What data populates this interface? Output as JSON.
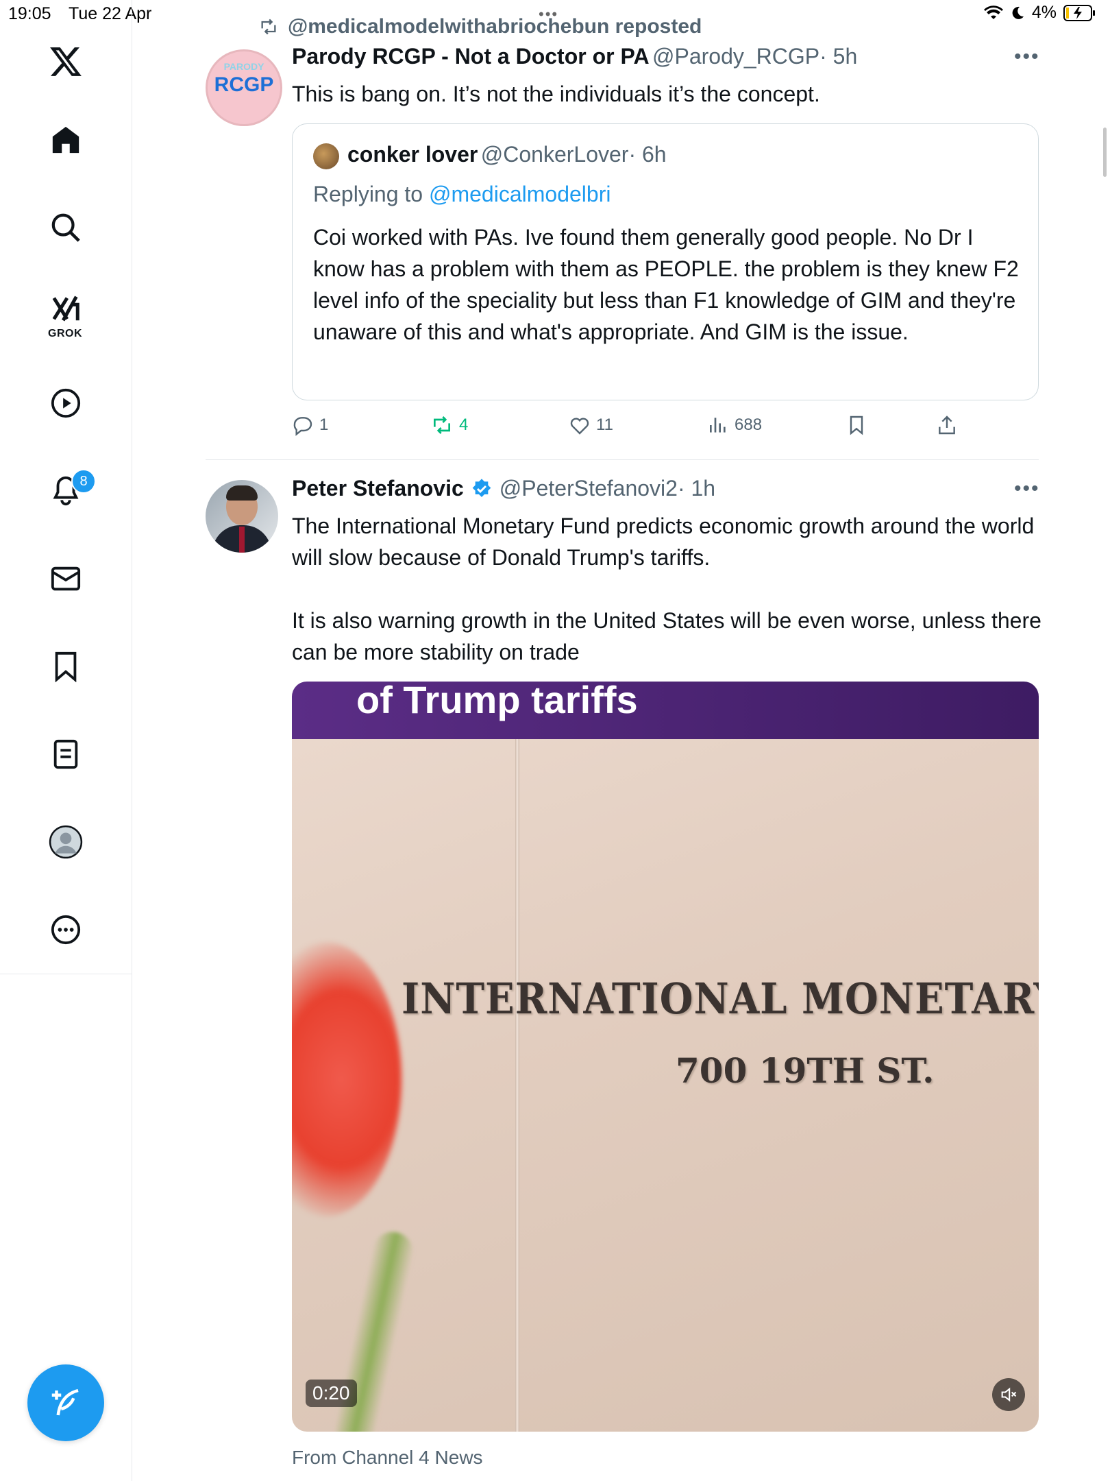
{
  "status_bar": {
    "time": "19:05",
    "date": "Tue 22 Apr",
    "battery": "4%"
  },
  "sidebar": {
    "items": [
      {
        "name": "home",
        "icon": "home-icon"
      },
      {
        "name": "search",
        "icon": "search-icon"
      },
      {
        "name": "grok",
        "icon": "grok-icon",
        "label": "GROK"
      },
      {
        "name": "videos",
        "icon": "play-icon"
      },
      {
        "name": "notifications",
        "icon": "bell-icon",
        "badge": "8"
      },
      {
        "name": "messages",
        "icon": "mail-icon"
      },
      {
        "name": "bookmarks",
        "icon": "bookmark-icon"
      },
      {
        "name": "lists",
        "icon": "list-icon"
      },
      {
        "name": "profile",
        "icon": "profile-icon"
      },
      {
        "name": "more",
        "icon": "more-icon"
      }
    ],
    "compose_icon": "compose-icon"
  },
  "repost": {
    "label": "@medicalmodelwithabriochebun reposted"
  },
  "tweet1": {
    "avatar_top": "PARODY",
    "avatar_main": "RCGP",
    "name": "Parody RCGP - Not a Doctor or PA",
    "handle": "@Parody_RCGP",
    "time": "· 5h",
    "text": "This is bang on. It’s not the individuals it’s the concept.",
    "quote": {
      "name": "conker lover",
      "handle": "@ConkerLover",
      "time": "· 6h",
      "replying_prefix": "Replying to ",
      "replying_to": "@medicalmodelbri",
      "text": "Coi worked with PAs. Ive found them generally good people. No Dr I know has a problem with them as PEOPLE. the problem is they knew F2 level info of the speciality but less than F1 knowledge of GIM and they're unaware of this and what's appropriate. And GIM is the issue."
    },
    "actions": {
      "replies": "1",
      "reposts": "4",
      "likes": "11",
      "views": "688"
    }
  },
  "tweet2": {
    "name": "Peter Stefanovic",
    "handle": "@PeterStefanovi2",
    "time": "· 1h",
    "text1": "The International Monetary Fund predicts economic growth around the world will slow because of Donald Trump's tariffs.",
    "text2": "It is also warning growth in the United States will be even worse, unless there can be more stability on trade",
    "media": {
      "banner": "of Trump tariffs",
      "sign_line1": "INTERNATIONAL  MONETARY",
      "sign_line2": "700 19TH ST.",
      "duration": "0:20"
    },
    "source": "From Channel 4 News"
  },
  "colors": {
    "accent": "#1d9bf0",
    "repost_green": "#00ba7c",
    "text": "#0f1419",
    "muted": "#536471"
  }
}
